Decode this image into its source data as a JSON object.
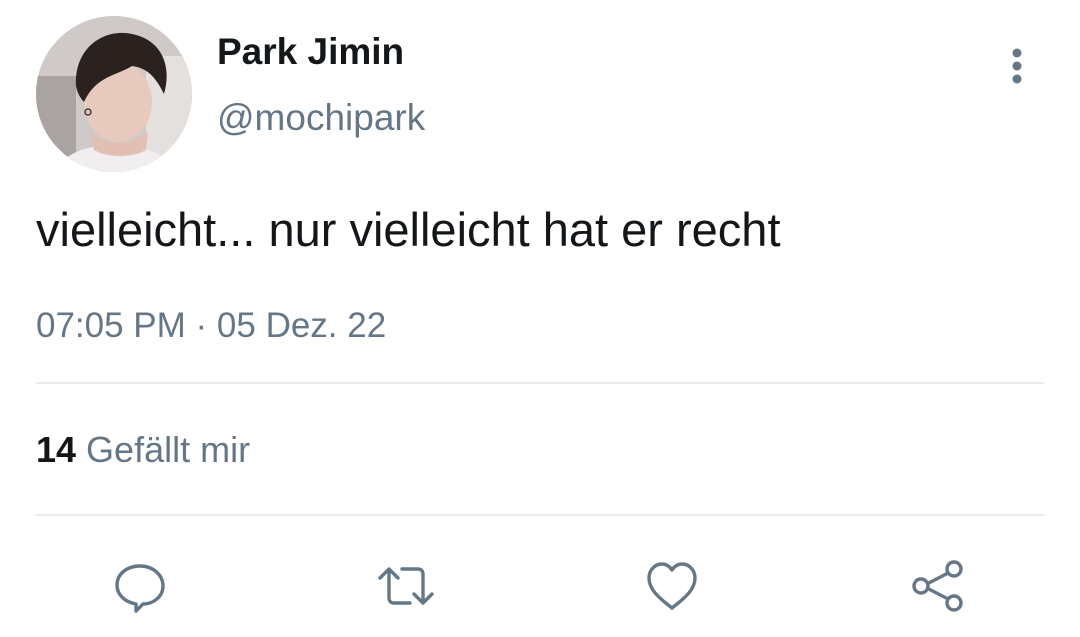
{
  "tweet": {
    "author": {
      "display_name": "Park Jimin",
      "handle": "@mochipark",
      "avatar_icon": "profile-photo"
    },
    "text": "vielleicht... nur vielleicht hat er recht",
    "timestamp": "07:05 PM · 05 Dez. 22",
    "stats": {
      "likes_count": "14",
      "likes_label": "Gefällt mir"
    },
    "actions": [
      {
        "icon": "reply-icon"
      },
      {
        "icon": "retweet-icon"
      },
      {
        "icon": "like-icon"
      },
      {
        "icon": "share-icon"
      }
    ],
    "more_icon": "more-vertical-icon"
  },
  "colors": {
    "text_primary": "#14171a",
    "text_secondary": "#657786",
    "divider": "#e6ecf0",
    "icon": "#657786"
  }
}
